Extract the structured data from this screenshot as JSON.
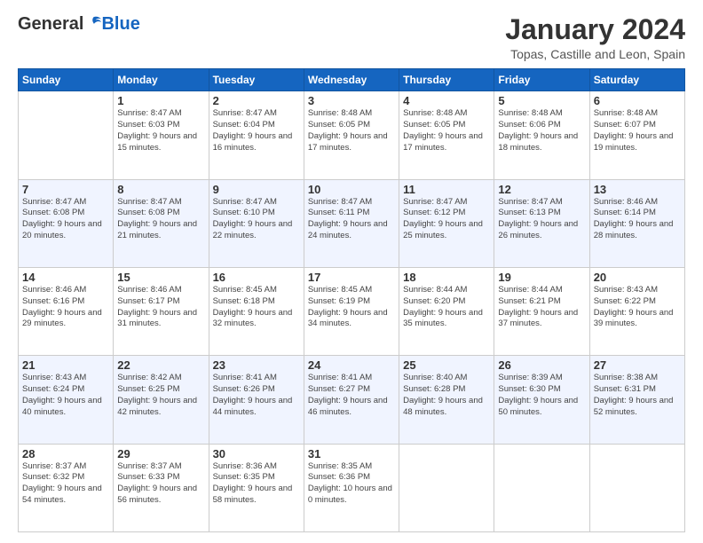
{
  "header": {
    "logo_general": "General",
    "logo_blue": "Blue",
    "title": "January 2024",
    "location": "Topas, Castille and Leon, Spain"
  },
  "weekdays": [
    "Sunday",
    "Monday",
    "Tuesday",
    "Wednesday",
    "Thursday",
    "Friday",
    "Saturday"
  ],
  "weeks": [
    [
      {
        "day": "",
        "info": ""
      },
      {
        "day": "1",
        "info": "Sunrise: 8:47 AM\nSunset: 6:03 PM\nDaylight: 9 hours\nand 15 minutes."
      },
      {
        "day": "2",
        "info": "Sunrise: 8:47 AM\nSunset: 6:04 PM\nDaylight: 9 hours\nand 16 minutes."
      },
      {
        "day": "3",
        "info": "Sunrise: 8:48 AM\nSunset: 6:05 PM\nDaylight: 9 hours\nand 17 minutes."
      },
      {
        "day": "4",
        "info": "Sunrise: 8:48 AM\nSunset: 6:05 PM\nDaylight: 9 hours\nand 17 minutes."
      },
      {
        "day": "5",
        "info": "Sunrise: 8:48 AM\nSunset: 6:06 PM\nDaylight: 9 hours\nand 18 minutes."
      },
      {
        "day": "6",
        "info": "Sunrise: 8:48 AM\nSunset: 6:07 PM\nDaylight: 9 hours\nand 19 minutes."
      }
    ],
    [
      {
        "day": "7",
        "info": ""
      },
      {
        "day": "8",
        "info": "Sunrise: 8:47 AM\nSunset: 6:08 PM\nDaylight: 9 hours\nand 21 minutes."
      },
      {
        "day": "9",
        "info": "Sunrise: 8:47 AM\nSunset: 6:10 PM\nDaylight: 9 hours\nand 22 minutes."
      },
      {
        "day": "10",
        "info": "Sunrise: 8:47 AM\nSunset: 6:11 PM\nDaylight: 9 hours\nand 24 minutes."
      },
      {
        "day": "11",
        "info": "Sunrise: 8:47 AM\nSunset: 6:12 PM\nDaylight: 9 hours\nand 25 minutes."
      },
      {
        "day": "12",
        "info": "Sunrise: 8:47 AM\nSunset: 6:13 PM\nDaylight: 9 hours\nand 26 minutes."
      },
      {
        "day": "13",
        "info": "Sunrise: 8:46 AM\nSunset: 6:14 PM\nDaylight: 9 hours\nand 28 minutes."
      }
    ],
    [
      {
        "day": "14",
        "info": ""
      },
      {
        "day": "15",
        "info": "Sunrise: 8:46 AM\nSunset: 6:17 PM\nDaylight: 9 hours\nand 31 minutes."
      },
      {
        "day": "16",
        "info": "Sunrise: 8:45 AM\nSunset: 6:18 PM\nDaylight: 9 hours\nand 32 minutes."
      },
      {
        "day": "17",
        "info": "Sunrise: 8:45 AM\nSunset: 6:19 PM\nDaylight: 9 hours\nand 34 minutes."
      },
      {
        "day": "18",
        "info": "Sunrise: 8:44 AM\nSunset: 6:20 PM\nDaylight: 9 hours\nand 35 minutes."
      },
      {
        "day": "19",
        "info": "Sunrise: 8:44 AM\nSunset: 6:21 PM\nDaylight: 9 hours\nand 37 minutes."
      },
      {
        "day": "20",
        "info": "Sunrise: 8:43 AM\nSunset: 6:22 PM\nDaylight: 9 hours\nand 39 minutes."
      }
    ],
    [
      {
        "day": "21",
        "info": ""
      },
      {
        "day": "22",
        "info": "Sunrise: 8:42 AM\nSunset: 6:25 PM\nDaylight: 9 hours\nand 42 minutes."
      },
      {
        "day": "23",
        "info": "Sunrise: 8:41 AM\nSunset: 6:26 PM\nDaylight: 9 hours\nand 44 minutes."
      },
      {
        "day": "24",
        "info": "Sunrise: 8:41 AM\nSunset: 6:27 PM\nDaylight: 9 hours\nand 46 minutes."
      },
      {
        "day": "25",
        "info": "Sunrise: 8:40 AM\nSunset: 6:28 PM\nDaylight: 9 hours\nand 48 minutes."
      },
      {
        "day": "26",
        "info": "Sunrise: 8:39 AM\nSunset: 6:30 PM\nDaylight: 9 hours\nand 50 minutes."
      },
      {
        "day": "27",
        "info": "Sunrise: 8:38 AM\nSunset: 6:31 PM\nDaylight: 9 hours\nand 52 minutes."
      }
    ],
    [
      {
        "day": "28",
        "info": "Sunrise: 8:37 AM\nSunset: 6:32 PM\nDaylight: 9 hours\nand 54 minutes."
      },
      {
        "day": "29",
        "info": "Sunrise: 8:37 AM\nSunset: 6:33 PM\nDaylight: 9 hours\nand 56 minutes."
      },
      {
        "day": "30",
        "info": "Sunrise: 8:36 AM\nSunset: 6:35 PM\nDaylight: 9 hours\nand 58 minutes."
      },
      {
        "day": "31",
        "info": "Sunrise: 8:35 AM\nSunset: 6:36 PM\nDaylight: 10 hours\nand 0 minutes."
      },
      {
        "day": "",
        "info": ""
      },
      {
        "day": "",
        "info": ""
      },
      {
        "day": "",
        "info": ""
      }
    ]
  ],
  "week7_sunday_info": "Sunrise: 8:47 AM\nSunset: 6:08 PM\nDaylight: 9 hours\nand 20 minutes.",
  "week14_sunday_info": "Sunrise: 8:46 AM\nSunset: 6:16 PM\nDaylight: 9 hours\nand 29 minutes.",
  "week21_sunday_info": "Sunrise: 8:43 AM\nSunset: 6:24 PM\nDaylight: 9 hours\nand 40 minutes."
}
